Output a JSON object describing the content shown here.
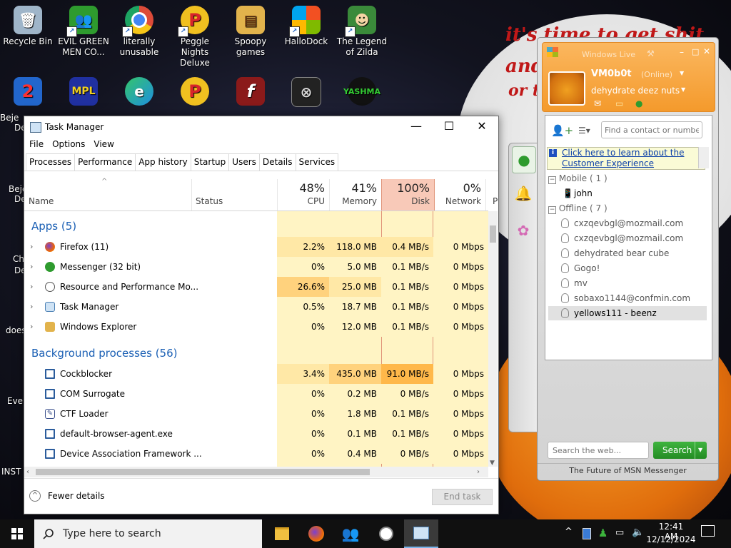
{
  "desktop": {
    "icons": [
      {
        "label": "Recycle Bin",
        "icon": "recycle-bin-icon",
        "color": "#9fb5c9",
        "glyph": "🗑"
      },
      {
        "label": "EVIL GREEN MEN CO...",
        "icon": "messenger-people-icon",
        "color": "#2e9b2e",
        "glyph": "👥"
      },
      {
        "label": "literally unusable",
        "icon": "chrome-icon",
        "color": "#dd4b39",
        "glyph": "●"
      },
      {
        "label": "Peggle Nights Deluxe",
        "icon": "peggle-icon",
        "color": "#d8242b",
        "glyph": "P"
      },
      {
        "label": "Spoopy games",
        "icon": "folder-icon",
        "color": "#e2b34c",
        "glyph": "📁"
      },
      {
        "label": "HalloDock",
        "icon": "windows-shield-icon",
        "color": "#2c7ee3",
        "glyph": "⛨"
      },
      {
        "label": "The Legend of Zilda",
        "icon": "zelda-icon",
        "color": "#3a8a3a",
        "glyph": "☻"
      }
    ],
    "second_row_icons": [
      {
        "label": "",
        "icon": "bejeweled-icon",
        "color": "#2266cc",
        "glyph": "2"
      },
      {
        "label": "",
        "icon": "mpl-icon",
        "color": "#2030a0",
        "glyph": "MPL"
      },
      {
        "label": "",
        "icon": "edge-icon",
        "color": "#1f8fe0",
        "glyph": "e"
      },
      {
        "label": "",
        "icon": "peggle-icon",
        "color": "#d8242b",
        "glyph": "P"
      },
      {
        "label": "",
        "icon": "flash-icon",
        "color": "#8b1a1a",
        "glyph": "f"
      },
      {
        "label": "",
        "icon": "remote-desktop-icon",
        "color": "#555555",
        "glyph": "⊗"
      },
      {
        "label": "",
        "icon": "yashma-icon",
        "color": "#111111",
        "glyph": "Y"
      }
    ],
    "edge_labels": [
      "Beje",
      "De",
      "Beje",
      "De",
      "Ch",
      "De",
      "does",
      "Ever",
      "INST"
    ],
    "meme_text": [
      "it's time to get shit",
      "and",
      "or t"
    ]
  },
  "task_manager": {
    "title": "Task Manager",
    "menu": [
      "File",
      "Options",
      "View"
    ],
    "tabs": [
      "Processes",
      "Performance",
      "App history",
      "Startup",
      "Users",
      "Details",
      "Services"
    ],
    "active_tab": "Processes",
    "columns": {
      "name": "Name",
      "status": "Status",
      "cpu": {
        "pct": "48%",
        "label": "CPU"
      },
      "memory": {
        "pct": "41%",
        "label": "Memory"
      },
      "disk": {
        "pct": "100%",
        "label": "Disk"
      },
      "network": {
        "pct": "0%",
        "label": "Network"
      },
      "power": "P"
    },
    "apps_header": "Apps (5)",
    "apps": [
      {
        "name": "Firefox (11)",
        "icon": "firefox-icon",
        "icon_color": "#e8650f",
        "cpu": "2.2%",
        "memory": "118.0 MB",
        "disk": "0.4 MB/s",
        "network": "0 Mbps"
      },
      {
        "name": "Messenger (32 bit)",
        "icon": "messenger-people-icon",
        "icon_color": "#2e9b2e",
        "cpu": "0%",
        "memory": "5.0 MB",
        "disk": "0.1 MB/s",
        "network": "0 Mbps"
      },
      {
        "name": "Resource and Performance Mo...",
        "icon": "resource-monitor-icon",
        "icon_color": "#c83c3c",
        "cpu": "26.6%",
        "memory": "25.0 MB",
        "disk": "0.1 MB/s",
        "network": "0 Mbps"
      },
      {
        "name": "Task Manager",
        "icon": "task-manager-icon",
        "icon_color": "#4a7fb3",
        "cpu": "0.5%",
        "memory": "18.7 MB",
        "disk": "0.1 MB/s",
        "network": "0 Mbps"
      },
      {
        "name": "Windows Explorer",
        "icon": "folder-icon",
        "icon_color": "#e2b34c",
        "cpu": "0%",
        "memory": "12.0 MB",
        "disk": "0.1 MB/s",
        "network": "0 Mbps"
      }
    ],
    "background_header": "Background processes (56)",
    "background": [
      {
        "name": "Cockblocker",
        "icon": "app-window-icon",
        "icon_color": "#2b5c9c",
        "cpu": "3.4%",
        "memory": "435.0 MB",
        "disk": "91.0 MB/s",
        "network": "0 Mbps"
      },
      {
        "name": "COM Surrogate",
        "icon": "app-window-icon",
        "icon_color": "#2b5c9c",
        "cpu": "0%",
        "memory": "0.2 MB",
        "disk": "0 MB/s",
        "network": "0 Mbps"
      },
      {
        "name": "CTF Loader",
        "icon": "ctf-loader-icon",
        "icon_color": "#3a4f8c",
        "cpu": "0%",
        "memory": "1.8 MB",
        "disk": "0.1 MB/s",
        "network": "0 Mbps"
      },
      {
        "name": "default-browser-agent.exe",
        "icon": "app-window-icon",
        "icon_color": "#2b5c9c",
        "cpu": "0%",
        "memory": "0.1 MB",
        "disk": "0.1 MB/s",
        "network": "0 Mbps"
      },
      {
        "name": "Device Association Framework ...",
        "icon": "app-window-icon",
        "icon_color": "#2b5c9c",
        "cpu": "0%",
        "memory": "0.4 MB",
        "disk": "0 MB/s",
        "network": "0 Mbps"
      }
    ],
    "fewer_details": "Fewer details",
    "end_task": "End task",
    "colors": {
      "light": "#fff4c4",
      "medium": "#ffe8a6",
      "strong": "#ffd27d",
      "disk_header": "#f8c9b8",
      "group_text": "#1a5fb4"
    }
  },
  "messenger": {
    "window_title": "Windows Live",
    "user_name": "VM0b0t",
    "status": "(Online)",
    "personal_message": "dehydrate deez nuts",
    "search_contacts_placeholder": "Find a contact or numbe",
    "promo_line1": "Click here to learn about the",
    "promo_line2": "Customer Experience",
    "groups": [
      {
        "label": "Mobile ( 1 )",
        "contacts": [
          "john"
        ]
      },
      {
        "label": "Offline ( 7 )",
        "contacts": [
          "cxzqevbgl@mozmail.com",
          "cxzqevbgl@mozmail.com",
          "dehydrated bear cube",
          "Gogo!",
          "mv",
          "sobaxo1144@confmin.com",
          "yellows111 - beenz"
        ]
      }
    ],
    "web_search_placeholder": "Search the web...",
    "search_button": "Search",
    "footer": "The Future of MSN Messenger",
    "colors": {
      "header_orange": "#f7a23c",
      "link_blue": "#0a3ea8",
      "search_green": "#2f9e2f"
    }
  },
  "taskbar": {
    "search_placeholder": "Type here to search",
    "time": "12:41 AM",
    "date": "12/12/2024",
    "pinned": [
      "file-explorer-icon",
      "firefox-icon",
      "messenger-people-icon",
      "resource-monitor-icon",
      "task-manager-icon"
    ]
  }
}
